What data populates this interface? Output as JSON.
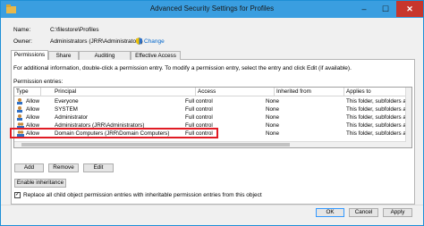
{
  "window": {
    "title": "Advanced Security Settings for Profiles"
  },
  "name_label": "Name:",
  "name_value": "C:\\filestore\\Profiles",
  "owner_label": "Owner:",
  "owner_value": "Administrators (JRR\\Administrators)",
  "change_link": "Change",
  "tabs": [
    "Permissions",
    "Share",
    "Auditing",
    "Effective Access"
  ],
  "info_text": "For additional information, double-click a permission entry. To modify a permission entry, select the entry and click Edit (if available).",
  "entries_label": "Permission entries:",
  "columns": [
    "Type",
    "Principal",
    "Access",
    "Inherited from",
    "Applies to"
  ],
  "rows": [
    {
      "type": "Allow",
      "principal": "Everyone",
      "access": "Full control",
      "inherited": "None",
      "applies": "This folder, subfolders and file"
    },
    {
      "type": "Allow",
      "principal": "SYSTEM",
      "access": "Full control",
      "inherited": "None",
      "applies": "This folder, subfolders and file"
    },
    {
      "type": "Allow",
      "principal": "Administrator",
      "access": "Full control",
      "inherited": "None",
      "applies": "This folder, subfolders and file"
    },
    {
      "type": "Allow",
      "principal": "Administrators (JRR\\Administrators)",
      "access": "Full control",
      "inherited": "None",
      "applies": "This folder, subfolders and file"
    },
    {
      "type": "Allow",
      "principal": "Domain Computers (JRR\\Domain Computers)",
      "access": "Full control",
      "inherited": "None",
      "applies": "This folder, subfolders and file"
    }
  ],
  "buttons": {
    "add": "Add",
    "remove": "Remove",
    "edit": "Edit",
    "enable_inheritance": "Enable inheritance",
    "ok": "OK",
    "cancel": "Cancel",
    "apply": "Apply"
  },
  "replace_checkbox": {
    "label": "Replace all child object permission entries with inheritable permission entries from this object",
    "checked": true
  },
  "colors": {
    "titlebar": "#3a9ee0",
    "close": "#c7362c",
    "highlight": "#e01b24",
    "link": "#0066cc"
  }
}
